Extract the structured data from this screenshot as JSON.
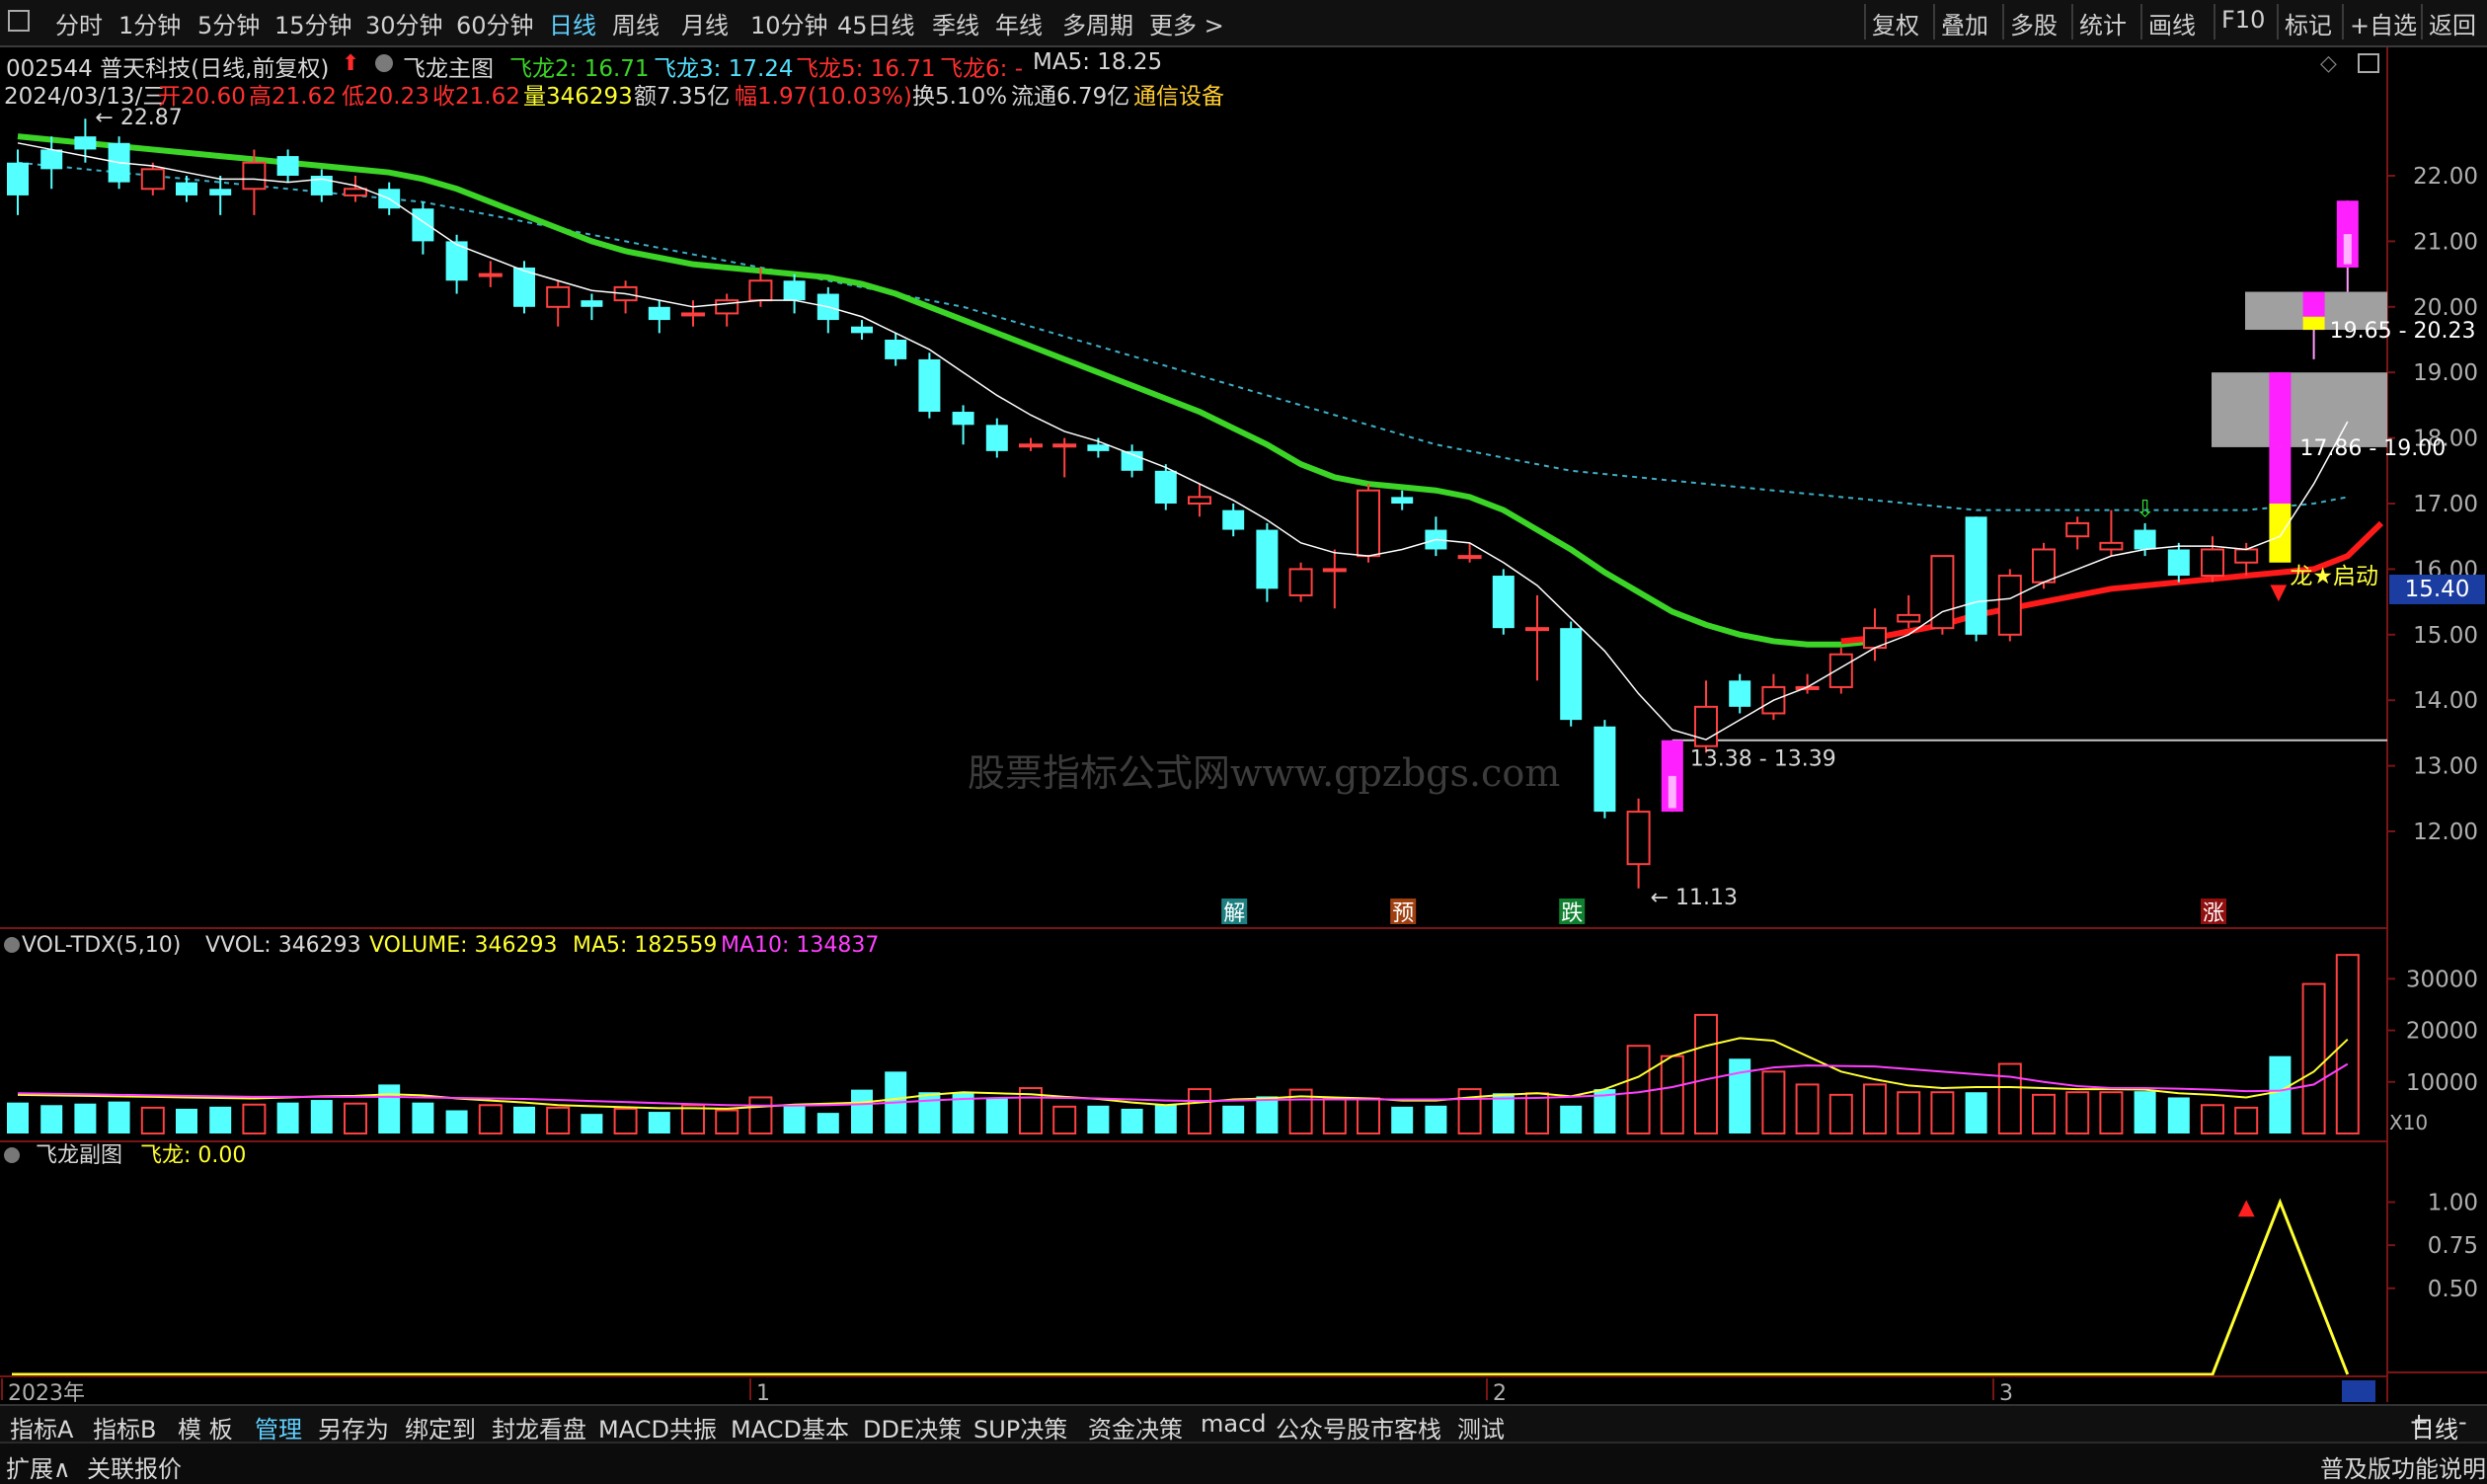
{
  "toolbar": {
    "tabs": [
      "分时",
      "1分钟",
      "5分钟",
      "15分钟",
      "30分钟",
      "60分钟",
      "日线",
      "周线",
      "月线",
      "10分钟",
      "45日线",
      "季线",
      "年线",
      "多周期",
      "更多 >"
    ],
    "active": "日线",
    "right_buttons": [
      "复权",
      "叠加",
      "多股",
      "统计",
      "画线",
      "F10",
      "标记",
      "+自选",
      "返回"
    ]
  },
  "header": {
    "stock": "002544 普天科技(日线,前复权)",
    "indicator": "飞龙主图",
    "fl2": "飞龙2: 16.71",
    "fl3": "飞龙3: 17.24",
    "fl5": "飞龙5: 16.71",
    "fl6": "飞龙6: -",
    "ma5": "MA5: 18.25",
    "date": "2024/03/13/三",
    "open": "开20.60",
    "high": "高21.62",
    "low": "低20.23",
    "close": "收21.62",
    "vol": "量346293",
    "amount": "额7.35亿",
    "change": "幅1.97(10.03%)",
    "turnover": "换5.10%",
    "float": "流通6.79亿",
    "sector": "通信设备"
  },
  "colors": {
    "up": "#ff4040",
    "down": "#54ffff",
    "green_line": "#3bd427",
    "red_line": "#ff1a1a",
    "ma_line": "#ffffff",
    "dash_line": "#3fb0c8",
    "magenta": "#ff20ff",
    "yellow": "#ffff00",
    "gray_zone": "#a0a0a0"
  },
  "chart_data": [
    {
      "type": "candlestick",
      "y_ticks": [
        "22.00",
        "21.00",
        "20.00",
        "19.00",
        "18.00",
        "17.00",
        "16.00",
        "15.00",
        "14.00",
        "13.00",
        "12.00"
      ],
      "ylim": [
        11.2,
        23.0
      ],
      "current_price": "15.40",
      "annotations": [
        "22.87",
        "11.13",
        "13.38 - 13.39",
        "17.86 - 19.00",
        "19.65 - 20.23",
        "龙★启动"
      ],
      "signals": [
        "解",
        "预",
        "跌",
        "涨"
      ],
      "x_labels": [
        "2023年",
        "1",
        "2",
        "3"
      ],
      "candles": [
        [
          22.2,
          21.7,
          22.4,
          21.4
        ],
        [
          22.4,
          22.1,
          22.6,
          21.8
        ],
        [
          22.6,
          22.4,
          22.87,
          22.2
        ],
        [
          22.5,
          21.9,
          22.6,
          21.8
        ],
        [
          21.8,
          22.1,
          22.2,
          21.7
        ],
        [
          21.9,
          21.7,
          22.0,
          21.6
        ],
        [
          21.8,
          21.7,
          22.0,
          21.4
        ],
        [
          21.8,
          22.2,
          22.4,
          21.4
        ],
        [
          22.3,
          22.0,
          22.4,
          21.9
        ],
        [
          22.0,
          21.7,
          22.1,
          21.6
        ],
        [
          21.7,
          21.8,
          22.0,
          21.6
        ],
        [
          21.8,
          21.5,
          21.9,
          21.4
        ],
        [
          21.5,
          21.0,
          21.6,
          20.8
        ],
        [
          21.0,
          20.4,
          21.1,
          20.2
        ],
        [
          20.5,
          20.5,
          20.7,
          20.3
        ],
        [
          20.6,
          20.0,
          20.7,
          19.9
        ],
        [
          20.0,
          20.3,
          20.4,
          19.7
        ],
        [
          20.1,
          20.0,
          20.2,
          19.8
        ],
        [
          20.1,
          20.3,
          20.4,
          19.9
        ],
        [
          20.0,
          19.8,
          20.1,
          19.6
        ],
        [
          19.9,
          19.9,
          20.1,
          19.7
        ],
        [
          19.9,
          20.1,
          20.2,
          19.7
        ],
        [
          20.1,
          20.4,
          20.6,
          20.0
        ],
        [
          20.4,
          20.1,
          20.5,
          19.9
        ],
        [
          20.2,
          19.8,
          20.3,
          19.6
        ],
        [
          19.7,
          19.6,
          19.8,
          19.5
        ],
        [
          19.5,
          19.2,
          19.6,
          19.1
        ],
        [
          19.2,
          18.4,
          19.3,
          18.3
        ],
        [
          18.4,
          18.2,
          18.5,
          17.9
        ],
        [
          18.2,
          17.8,
          18.3,
          17.7
        ],
        [
          17.9,
          17.9,
          18.0,
          17.8
        ],
        [
          17.9,
          17.9,
          18.0,
          17.4
        ],
        [
          17.9,
          17.8,
          18.0,
          17.7
        ],
        [
          17.8,
          17.5,
          17.9,
          17.4
        ],
        [
          17.5,
          17.0,
          17.6,
          16.9
        ],
        [
          17.0,
          17.1,
          17.3,
          16.8
        ],
        [
          16.9,
          16.6,
          17.0,
          16.5
        ],
        [
          16.6,
          15.7,
          16.7,
          15.5
        ],
        [
          15.6,
          16.0,
          16.1,
          15.5
        ],
        [
          16.0,
          16.0,
          16.3,
          15.4
        ],
        [
          16.2,
          17.2,
          17.3,
          16.1
        ],
        [
          17.1,
          17.0,
          17.2,
          16.9
        ],
        [
          16.6,
          16.3,
          16.8,
          16.2
        ],
        [
          16.2,
          16.2,
          16.4,
          16.1
        ],
        [
          15.9,
          15.1,
          16.0,
          15.0
        ],
        [
          15.1,
          15.1,
          15.6,
          14.3
        ],
        [
          15.1,
          13.7,
          15.2,
          13.6
        ],
        [
          13.6,
          12.3,
          13.7,
          12.2
        ],
        [
          11.5,
          12.3,
          12.5,
          11.13
        ],
        [
          12.3,
          13.39,
          13.39,
          12.3
        ],
        [
          13.3,
          13.9,
          14.3,
          13.2
        ],
        [
          14.3,
          13.9,
          14.4,
          13.8
        ],
        [
          13.8,
          14.2,
          14.4,
          13.7
        ],
        [
          14.2,
          14.2,
          14.4,
          14.1
        ],
        [
          14.2,
          14.7,
          14.8,
          14.1
        ],
        [
          14.8,
          15.1,
          15.4,
          14.6
        ],
        [
          15.2,
          15.3,
          15.6,
          15.1
        ],
        [
          15.1,
          16.2,
          16.2,
          15.0
        ],
        [
          16.8,
          15.0,
          16.8,
          14.9
        ],
        [
          15.0,
          15.9,
          16.0,
          14.9
        ],
        [
          15.8,
          16.3,
          16.4,
          15.7
        ],
        [
          16.5,
          16.7,
          16.8,
          16.3
        ],
        [
          16.3,
          16.4,
          16.9,
          16.2
        ],
        [
          16.6,
          16.3,
          16.7,
          16.2
        ],
        [
          16.3,
          15.9,
          16.4,
          15.8
        ],
        [
          15.9,
          16.3,
          16.5,
          15.8
        ],
        [
          16.1,
          16.3,
          16.4,
          15.9
        ],
        [
          17.86,
          17.0,
          19.0,
          17.0
        ],
        [
          19.65,
          20.23,
          20.23,
          19.2
        ],
        [
          20.6,
          21.62,
          21.62,
          20.23
        ]
      ],
      "ma5": [
        22.5,
        22.4,
        22.3,
        22.2,
        22.15,
        22.05,
        21.95,
        21.95,
        21.9,
        21.95,
        21.85,
        21.65,
        21.3,
        20.95,
        20.75,
        20.55,
        20.4,
        20.25,
        20.2,
        20.1,
        20.0,
        20.05,
        20.1,
        20.1,
        20.0,
        19.85,
        19.6,
        19.35,
        19.0,
        18.65,
        18.35,
        18.1,
        17.95,
        17.75,
        17.55,
        17.3,
        17.05,
        16.75,
        16.4,
        16.25,
        16.2,
        16.3,
        16.45,
        16.4,
        16.1,
        15.75,
        15.25,
        14.75,
        14.1,
        13.55,
        13.4,
        13.7,
        14.0,
        14.2,
        14.5,
        14.8,
        15.0,
        15.35,
        15.5,
        15.55,
        15.8,
        16.0,
        16.2,
        16.3,
        16.35,
        16.35,
        16.3,
        16.5,
        17.3,
        18.25
      ],
      "green_line": [
        22.6,
        22.55,
        22.5,
        22.45,
        22.4,
        22.35,
        22.3,
        22.25,
        22.2,
        22.15,
        22.1,
        22.05,
        21.95,
        21.8,
        21.6,
        21.4,
        21.2,
        21.0,
        20.85,
        20.75,
        20.65,
        20.6,
        20.55,
        20.5,
        20.45,
        20.35,
        20.2,
        20.0,
        19.8,
        19.6,
        19.4,
        19.2,
        19.0,
        18.8,
        18.6,
        18.4,
        18.15,
        17.9,
        17.6,
        17.4,
        17.3,
        17.25,
        17.2,
        17.1,
        16.9,
        16.6,
        16.3,
        15.95,
        15.65,
        15.35,
        15.15,
        15.0,
        14.9,
        14.85,
        14.85,
        14.9
      ],
      "red_line_start": 54,
      "red_line": [
        14.9,
        14.95,
        15.05,
        15.15,
        15.3,
        15.4,
        15.5,
        15.6,
        15.7,
        15.75,
        15.8,
        15.85,
        15.9,
        15.95,
        16.0,
        16.2,
        16.7
      ],
      "dash_line": [
        22.2,
        22.15,
        22.1,
        22.05,
        22.0,
        21.95,
        21.9,
        21.85,
        21.8,
        21.75,
        21.7,
        21.65,
        21.6,
        21.5,
        21.4,
        21.3,
        21.2,
        21.1,
        21.0,
        20.9,
        20.8,
        20.7,
        20.6,
        20.5,
        20.4,
        20.3,
        20.2,
        20.1,
        20.0,
        19.85,
        19.7,
        19.55,
        19.4,
        19.25,
        19.1,
        18.95,
        18.8,
        18.65,
        18.5,
        18.35,
        18.2,
        18.05,
        17.9,
        17.8,
        17.7,
        17.6,
        17.5,
        17.45,
        17.4,
        17.35,
        17.3,
        17.25,
        17.2,
        17.15,
        17.1,
        17.05,
        17.0,
        16.95,
        16.9,
        16.9,
        16.9,
        16.9,
        16.9,
        16.9,
        16.9,
        16.9,
        16.9,
        16.95,
        17.0,
        17.1
      ]
    },
    {
      "type": "bar",
      "title": "VOL-TDX(5,10)",
      "legend": [
        "VVOL: 346293",
        "VOLUME: 346293",
        "MA5: 182559",
        "MA10: 134837"
      ],
      "y_ticks": [
        "30000",
        "20000",
        "10000"
      ],
      "unit": "X10",
      "ylim": [
        0,
        36000
      ],
      "volumes": [
        6000,
        5500,
        5800,
        6200,
        5000,
        4800,
        5200,
        5600,
        6000,
        6500,
        5800,
        9500,
        6000,
        4500,
        5500,
        5200,
        5000,
        3800,
        4800,
        4200,
        5500,
        4500,
        7000,
        5600,
        4000,
        8500,
        12000,
        8000,
        8000,
        6800,
        8800,
        5200,
        5400,
        4800,
        5600,
        8600,
        5400,
        7200,
        8500,
        6800,
        6800,
        5200,
        5400,
        8600,
        7800,
        7800,
        5400,
        8600,
        17000,
        15000,
        23000,
        14500,
        12000,
        9500,
        7500,
        9500,
        8000,
        8000,
        8000,
        13500,
        7500,
        8000,
        8000,
        8200,
        7000,
        5500,
        5000,
        15000,
        29000,
        34629
      ],
      "ma5": [
        7500,
        7400,
        7300,
        7200,
        7100,
        7000,
        6900,
        6800,
        7000,
        7200,
        7300,
        7600,
        7400,
        6800,
        6400,
        6000,
        5500,
        5300,
        5100,
        4900,
        4900,
        4800,
        5200,
        5600,
        5800,
        6000,
        6700,
        7500,
        8000,
        7800,
        7600,
        7100,
        6700,
        6000,
        5500,
        6000,
        6600,
        6800,
        7200,
        7000,
        6800,
        6400,
        6400,
        7000,
        7500,
        7800,
        7200,
        8600,
        11000,
        15000,
        17000,
        18500,
        18000,
        15000,
        12000,
        10500,
        9300,
        8800,
        9000,
        9000,
        8800,
        8600,
        8600,
        8500,
        7800,
        7500,
        7000,
        8200,
        12000,
        18256
      ],
      "ma10": [
        7800,
        7700,
        7600,
        7500,
        7400,
        7300,
        7200,
        7100,
        7100,
        7100,
        7100,
        7100,
        7000,
        6900,
        6800,
        6700,
        6500,
        6300,
        6100,
        5900,
        5700,
        5500,
        5400,
        5400,
        5500,
        5700,
        6000,
        6400,
        6700,
        6900,
        7000,
        6900,
        6800,
        6600,
        6400,
        6300,
        6400,
        6500,
        6600,
        6600,
        6600,
        6600,
        6600,
        6700,
        6800,
        6900,
        7100,
        7400,
        8000,
        9000,
        10500,
        11800,
        12800,
        13200,
        13100,
        13000,
        12500,
        12000,
        11500,
        11000,
        10000,
        9200,
        8800,
        8800,
        8700,
        8500,
        8200,
        8300,
        9500,
        13484
      ]
    },
    {
      "type": "line",
      "title": "飞龙副图",
      "legend": [
        "飞龙: 0.00"
      ],
      "y_ticks": [
        "1.00",
        "0.75",
        "0.50"
      ],
      "ylim": [
        0,
        1.1
      ],
      "values_index": [
        0,
        65,
        67,
        69
      ],
      "values": [
        0,
        0,
        1,
        0
      ]
    }
  ],
  "bottom": {
    "tabs": [
      "指标A",
      "指标B",
      "模 板",
      "管理",
      "另存为",
      "绑定到",
      "封龙看盘",
      "MACD共振",
      "MACD基本",
      "DDE决策",
      "SUP决策",
      "资金决策",
      "macd",
      "公众号股市客栈",
      "测试"
    ],
    "active": "管理",
    "right_label": "日线",
    "left2": "扩展∧",
    "quote": "关联报价",
    "right2": "普及版功能说明"
  },
  "watermark": "股票指标公式网www.gpzbgs.com"
}
